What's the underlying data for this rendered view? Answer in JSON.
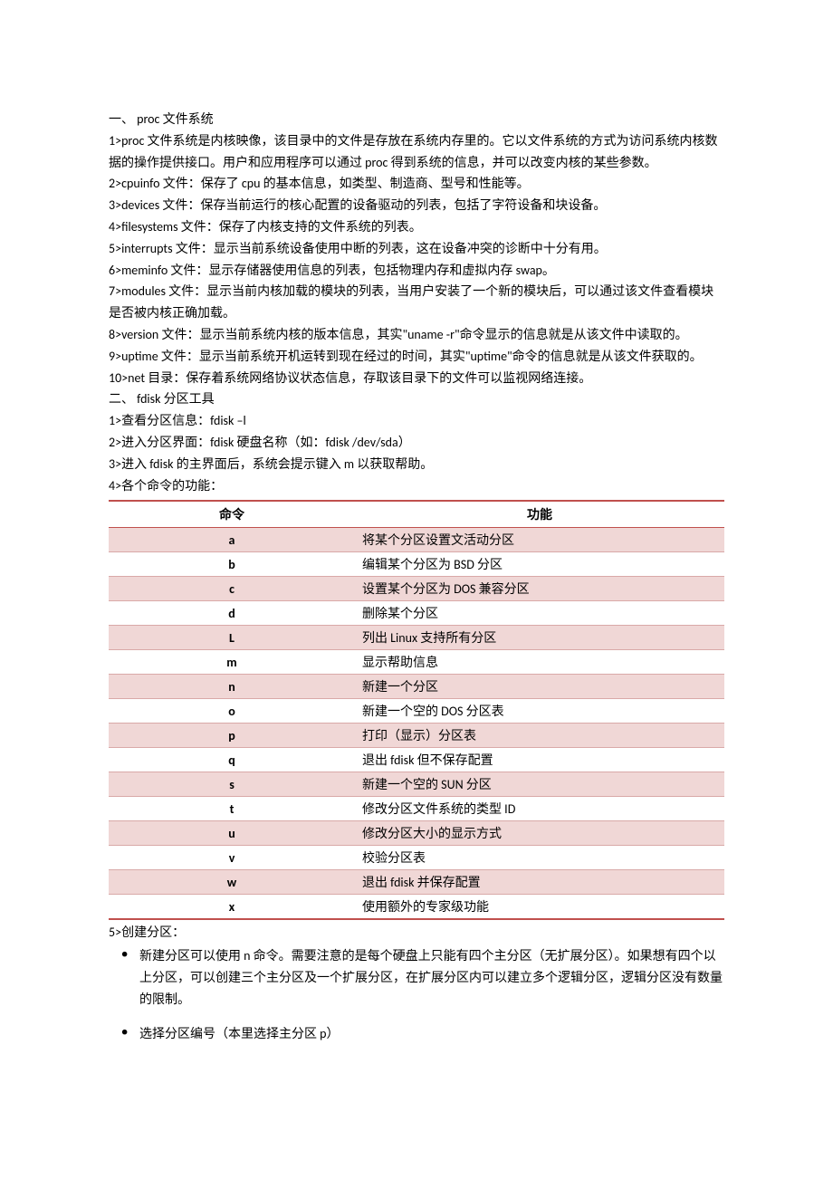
{
  "section1": {
    "title": "一、 proc 文件系统",
    "items": [
      "1>proc 文件系统是内核映像，该目录中的文件是存放在系统内存里的。它以文件系统的方式为访问系统内核数据的操作提供接口。用户和应用程序可以通过 proc 得到系统的信息，并可以改变内核的某些参数。",
      "2>cpuinfo 文件：保存了 cpu 的基本信息，如类型、制造商、型号和性能等。",
      "3>devices 文件：保存当前运行的核心配置的设备驱动的列表，包括了字符设备和块设备。",
      "4>filesystems 文件：保存了内核支持的文件系统的列表。",
      "5>interrupts 文件：显示当前系统设备使用中断的列表，这在设备冲突的诊断中十分有用。",
      "6>meminfo 文件：显示存储器使用信息的列表，包括物理内存和虚拟内存 swap。",
      "7>modules 文件：显示当前内核加载的模块的列表，当用户安装了一个新的模块后，可以通过该文件查看模块是否被内核正确加载。",
      "8>version 文件：显示当前系统内核的版本信息，其实\"uname -r\"命令显示的信息就是从该文件中读取的。",
      "9>uptime 文件：显示当前系统开机运转到现在经过的时间，其实\"uptime\"命令的信息就是从该文件获取的。",
      "10>net 目录：保存着系统网络协议状态信息，存取该目录下的文件可以监视网络连接。"
    ]
  },
  "section2": {
    "title": "二、 fdisk 分区工具",
    "items": [
      "1>查看分区信息：fdisk –l",
      "2>进入分区界面：fdisk  硬盘名称（如：fdisk /dev/sda）",
      "3>进入 fdisk 的主界面后，系统会提示键入 m 以获取帮助。",
      "4>各个命令的功能："
    ],
    "table": {
      "headers": [
        "命令",
        "功能"
      ],
      "rows": [
        {
          "cmd": "a",
          "desc": "将某个分区设置文活动分区"
        },
        {
          "cmd": "b",
          "desc": "编辑某个分区为 BSD 分区"
        },
        {
          "cmd": "c",
          "desc": "设置某个分区为 DOS 兼容分区"
        },
        {
          "cmd": "d",
          "desc": "删除某个分区"
        },
        {
          "cmd": "L",
          "desc": "列出 Linux 支持所有分区"
        },
        {
          "cmd": "m",
          "desc": "显示帮助信息"
        },
        {
          "cmd": "n",
          "desc": "新建一个分区"
        },
        {
          "cmd": "o",
          "desc": "新建一个空的 DOS 分区表"
        },
        {
          "cmd": "p",
          "desc": "打印（显示）分区表"
        },
        {
          "cmd": "q",
          "desc": "退出 fdisk 但不保存配置"
        },
        {
          "cmd": "s",
          "desc": "新建一个空的 SUN 分区"
        },
        {
          "cmd": "t",
          "desc": "修改分区文件系统的类型 ID"
        },
        {
          "cmd": "u",
          "desc": "修改分区大小的显示方式"
        },
        {
          "cmd": "v",
          "desc": "校验分区表"
        },
        {
          "cmd": "w",
          "desc": "退出 fdisk 并保存配置"
        },
        {
          "cmd": "x",
          "desc": "使用额外的专家级功能"
        }
      ]
    },
    "item5": "5>创建分区：",
    "bullets": [
      "新建分区可以使用 n 命令。需要注意的是每个硬盘上只能有四个主分区（无扩展分区）。如果想有四个以上分区，可以创建三个主分区及一个扩展分区，在扩展分区内可以建立多个逻辑分区，逻辑分区没有数量的限制。",
      "选择分区编号（本里选择主分区 p）"
    ]
  }
}
